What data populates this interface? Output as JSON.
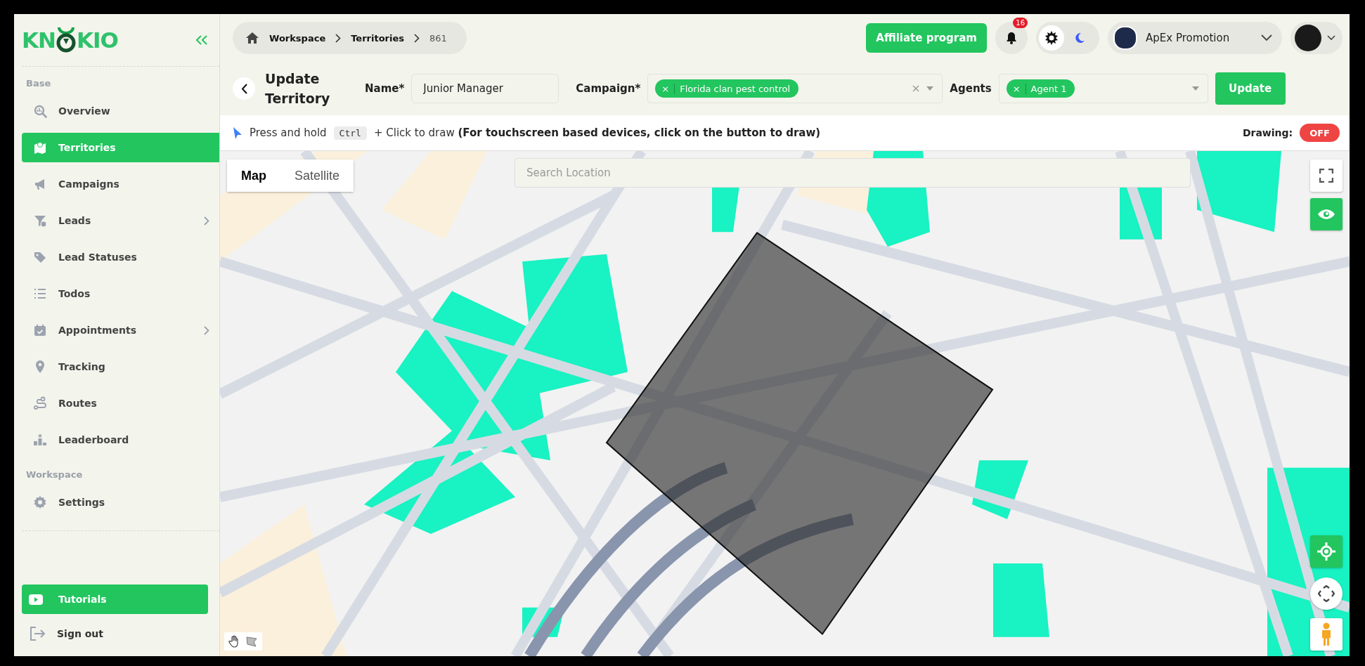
{
  "sidebar": {
    "logo_start": "KN",
    "logo_end": "KIO",
    "sections": [
      {
        "title": "Base",
        "items": [
          {
            "label": "Overview",
            "selected": false,
            "has_submenu": false
          },
          {
            "label": "Territories",
            "selected": true,
            "has_submenu": false
          },
          {
            "label": "Campaigns",
            "selected": false,
            "has_submenu": false
          },
          {
            "label": "Leads",
            "selected": false,
            "has_submenu": true
          },
          {
            "label": "Lead Statuses",
            "selected": false,
            "has_submenu": false
          },
          {
            "label": "Todos",
            "selected": false,
            "has_submenu": false
          },
          {
            "label": "Appointments",
            "selected": false,
            "has_submenu": true
          },
          {
            "label": "Tracking",
            "selected": false,
            "has_submenu": false
          },
          {
            "label": "Routes",
            "selected": false,
            "has_submenu": false
          },
          {
            "label": "Leaderboard",
            "selected": false,
            "has_submenu": false
          }
        ]
      },
      {
        "title": "Workspace",
        "items": [
          {
            "label": "Settings",
            "selected": false,
            "has_submenu": false
          }
        ]
      }
    ],
    "tutorials": "Tutorials",
    "sign_out": "Sign out"
  },
  "header": {
    "breadcrumb": [
      "Workspace",
      "Territories",
      "861"
    ],
    "affiliate": "Affiliate program",
    "notification_count": "16",
    "theme_modes": [
      {
        "selected": true
      },
      {
        "selected": false
      }
    ],
    "organization": "ApEx Promotion"
  },
  "form": {
    "title": "Update Territory",
    "name_label": "Name*",
    "name_value": "Junior Manager",
    "campaign_label": "Campaign*",
    "remove_symbol": "×",
    "campaign_tags": [
      "Florida clan pest control"
    ],
    "agents_label": "Agents",
    "agent_tags": [
      "Agent 1"
    ],
    "submit": "Update"
  },
  "hint": {
    "before": "Press and hold",
    "key": "Ctrl",
    "after": "+ Click to draw **(For touchscreen based devices, click on the button to draw)**",
    "drawing_label": "Drawing:",
    "drawing_on": false,
    "drawing_state": "OFF"
  },
  "map": {
    "modes": [
      {
        "label": "Map",
        "selected": true
      },
      {
        "label": "Satellite",
        "selected": false
      }
    ],
    "search_placeholder": "Search Location"
  }
}
